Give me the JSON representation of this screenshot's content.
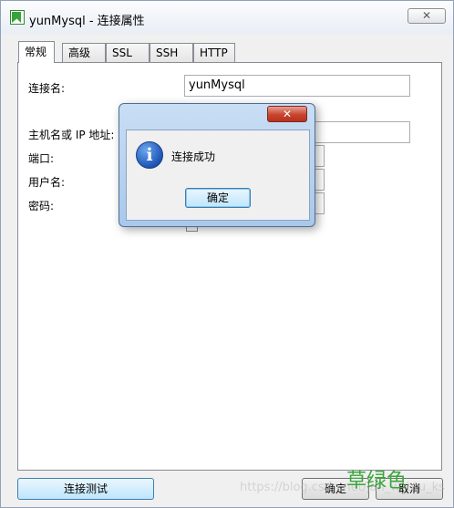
{
  "window": {
    "title": "yunMysql - 连接属性",
    "close_glyph": "✕"
  },
  "tabs": [
    {
      "label": "常规"
    },
    {
      "label": "高级"
    },
    {
      "label": "SSL"
    },
    {
      "label": "SSH"
    },
    {
      "label": "HTTP"
    }
  ],
  "form": {
    "connection_name_label": "连接名:",
    "connection_name_value": "yunMysql",
    "host_label": "主机名或 IP 地址:",
    "port_label": "端口:",
    "username_label": "用户名:",
    "password_label": "密码:"
  },
  "footer": {
    "test_connection_label": "连接测试",
    "ok_label": "确定",
    "cancel_label": "取消"
  },
  "dialog": {
    "close_glyph": "✕",
    "info_glyph": "i",
    "message": "连接成功",
    "ok_label": "确定"
  },
  "watermark": {
    "text": "https://blog.csdn.net/jan_w_btu_ks",
    "logo": "草绿色"
  },
  "colors": {
    "accent_button": "#bee6fd",
    "dialog_frame": "#a9c8ea",
    "close_red": "#c8442e",
    "watermark_green": "#3aa63a"
  }
}
